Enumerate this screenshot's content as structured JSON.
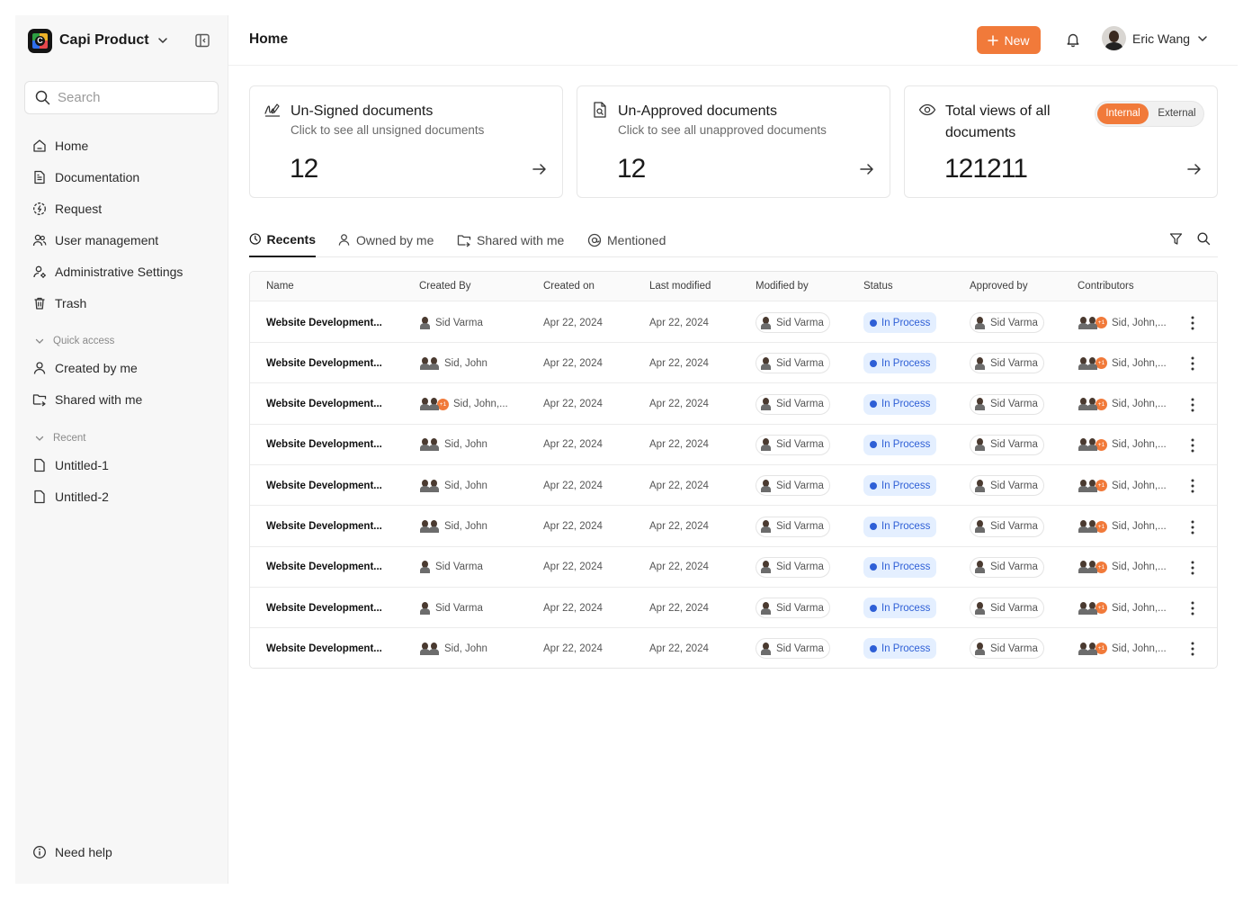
{
  "brand": {
    "name": "Capi Product"
  },
  "search": {
    "placeholder": "Search"
  },
  "nav": [
    {
      "label": "Home",
      "icon": "home-icon"
    },
    {
      "label": "Documentation",
      "icon": "document-icon"
    },
    {
      "label": "Request",
      "icon": "request-icon"
    },
    {
      "label": "User management",
      "icon": "users-icon"
    },
    {
      "label": "Administrative Settings",
      "icon": "admin-settings-icon"
    },
    {
      "label": "Trash",
      "icon": "trash-icon"
    }
  ],
  "quick_access": {
    "label": "Quick access",
    "items": [
      {
        "label": "Created by me",
        "icon": "user-icon"
      },
      {
        "label": "Shared with me",
        "icon": "shared-folder-icon"
      }
    ]
  },
  "recent": {
    "label": "Recent",
    "items": [
      {
        "label": "Untitled-1",
        "icon": "file-icon"
      },
      {
        "label": "Untitled-2",
        "icon": "file-icon"
      }
    ]
  },
  "help": {
    "label": "Need help"
  },
  "header": {
    "title": "Home",
    "new_label": "New",
    "user_name": "Eric Wang",
    "accent": "#f17a3a"
  },
  "cards": {
    "unsigned": {
      "title": "Un-Signed documents",
      "subtitle": "Click to see all unsigned documents",
      "value": "12"
    },
    "unapproved": {
      "title": "Un-Approved documents",
      "subtitle": "Click to see all unapproved documents",
      "value": "12"
    },
    "views": {
      "title": "Total views of all documents",
      "value": "121211",
      "toggle_internal": "Internal",
      "toggle_external": "External"
    }
  },
  "tabs": [
    {
      "label": "Recents",
      "icon": "clock-icon",
      "active": true
    },
    {
      "label": "Owned by me",
      "icon": "user-icon",
      "active": false
    },
    {
      "label": "Shared with me",
      "icon": "shared-folder-icon",
      "active": false
    },
    {
      "label": "Mentioned",
      "icon": "at-icon",
      "active": false
    }
  ],
  "table": {
    "columns": [
      "Name",
      "Created By",
      "Created on",
      "Last modified",
      "Modified by",
      "Status",
      "Approved by",
      "Contributors"
    ],
    "rows": [
      {
        "name": "Website Development...",
        "created_by": "Sid Varma",
        "created_avatars": 1,
        "created_extra": "",
        "created_on": "Apr 22, 2024",
        "last_modified": "Apr 22, 2024",
        "modified_by": "Sid Varma",
        "status": "In Process",
        "approved_by": "Sid Varma",
        "contributors": "Sid, John,...",
        "contrib_extra": "+1"
      },
      {
        "name": "Website Development...",
        "created_by": "Sid, John",
        "created_avatars": 2,
        "created_extra": "",
        "created_on": "Apr 22, 2024",
        "last_modified": "Apr 22, 2024",
        "modified_by": "Sid Varma",
        "status": "In Process",
        "approved_by": "Sid Varma",
        "contributors": "Sid, John,...",
        "contrib_extra": "+1"
      },
      {
        "name": "Website Development...",
        "created_by": "Sid, John,...",
        "created_avatars": 2,
        "created_extra": "+1",
        "created_on": "Apr 22, 2024",
        "last_modified": "Apr 22, 2024",
        "modified_by": "Sid Varma",
        "status": "In Process",
        "approved_by": "Sid Varma",
        "contributors": "Sid, John,...",
        "contrib_extra": "+1"
      },
      {
        "name": "Website Development...",
        "created_by": "Sid, John",
        "created_avatars": 2,
        "created_extra": "",
        "created_on": "Apr 22, 2024",
        "last_modified": "Apr 22, 2024",
        "modified_by": "Sid Varma",
        "status": "In Process",
        "approved_by": "Sid Varma",
        "contributors": "Sid, John,...",
        "contrib_extra": "+1"
      },
      {
        "name": "Website Development...",
        "created_by": "Sid, John",
        "created_avatars": 2,
        "created_extra": "",
        "created_on": "Apr 22, 2024",
        "last_modified": "Apr 22, 2024",
        "modified_by": "Sid Varma",
        "status": "In Process",
        "approved_by": "Sid Varma",
        "contributors": "Sid, John,...",
        "contrib_extra": "+1"
      },
      {
        "name": "Website Development...",
        "created_by": "Sid, John",
        "created_avatars": 2,
        "created_extra": "",
        "created_on": "Apr 22, 2024",
        "last_modified": "Apr 22, 2024",
        "modified_by": "Sid Varma",
        "status": "In Process",
        "approved_by": "Sid Varma",
        "contributors": "Sid, John,...",
        "contrib_extra": "+1"
      },
      {
        "name": "Website Development...",
        "created_by": "Sid Varma",
        "created_avatars": 1,
        "created_extra": "",
        "created_on": "Apr 22, 2024",
        "last_modified": "Apr 22, 2024",
        "modified_by": "Sid Varma",
        "status": "In Process",
        "approved_by": "Sid Varma",
        "contributors": "Sid, John,...",
        "contrib_extra": "+1"
      },
      {
        "name": "Website Development...",
        "created_by": "Sid Varma",
        "created_avatars": 1,
        "created_extra": "",
        "created_on": "Apr 22, 2024",
        "last_modified": "Apr 22, 2024",
        "modified_by": "Sid Varma",
        "status": "In Process",
        "approved_by": "Sid Varma",
        "contributors": "Sid, John,...",
        "contrib_extra": "+1"
      },
      {
        "name": "Website Development...",
        "created_by": "Sid, John",
        "created_avatars": 2,
        "created_extra": "",
        "created_on": "Apr 22, 2024",
        "last_modified": "Apr 22, 2024",
        "modified_by": "Sid Varma",
        "status": "In Process",
        "approved_by": "Sid Varma",
        "contributors": "Sid, John,...",
        "contrib_extra": "+1"
      }
    ]
  }
}
